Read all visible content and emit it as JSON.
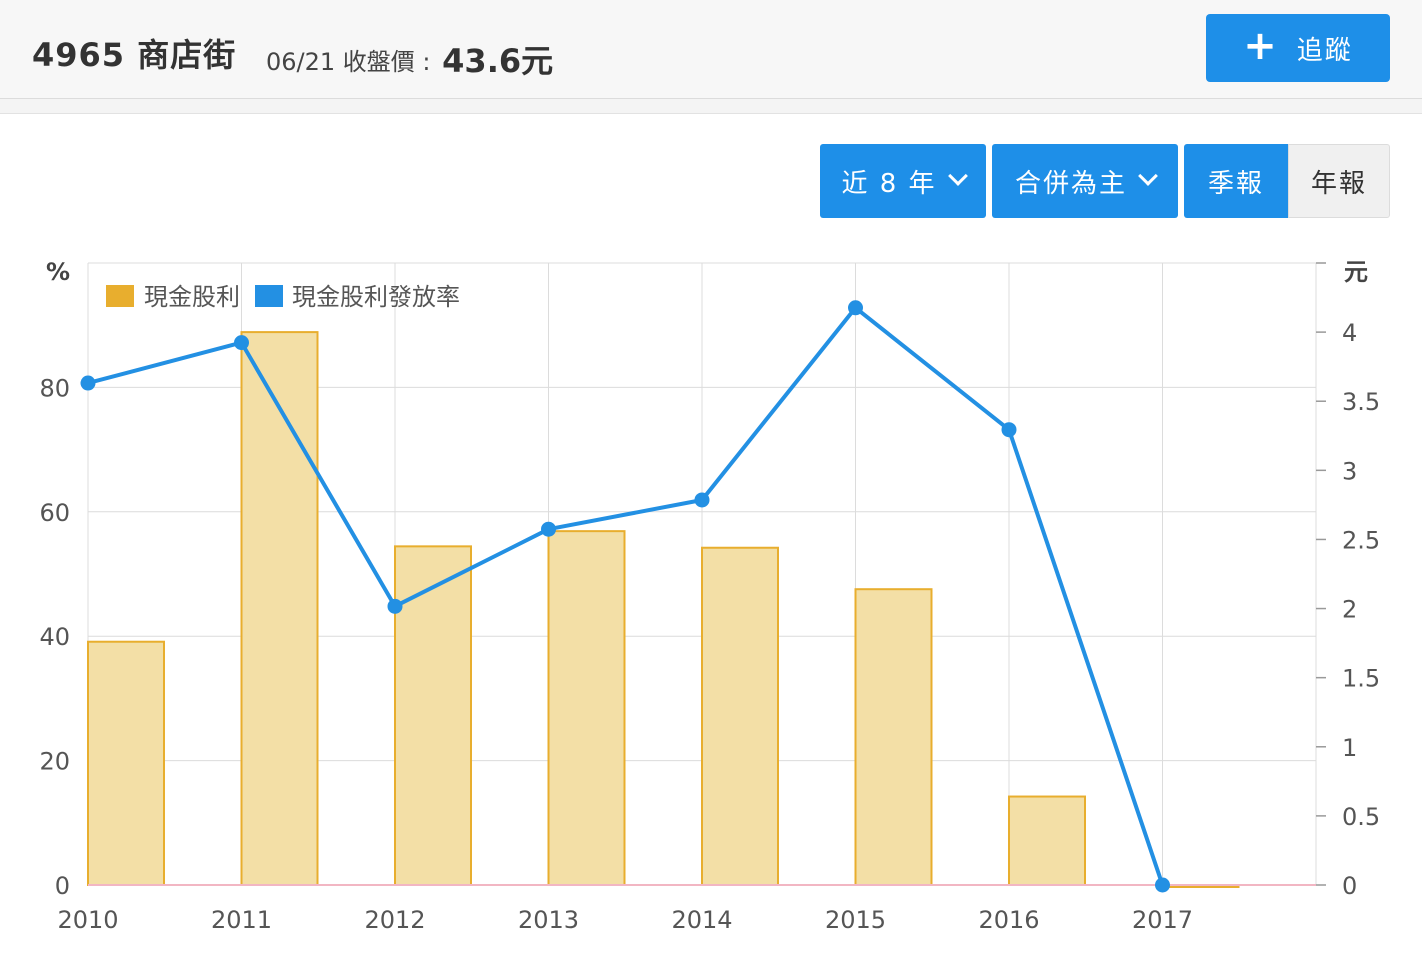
{
  "header": {
    "stock_title": "4965 商店街",
    "price_label": "06/21 收盤價 :",
    "price_value": "43.6元",
    "track_button": "追蹤"
  },
  "controls": {
    "range": "近 8 年",
    "basis": "合併為主",
    "quarterly": "季報",
    "annual": "年報"
  },
  "colors": {
    "accent": "#1e8fe8",
    "bar_fill": "#f3dfa6",
    "bar_stroke": "#e8ae2e",
    "line": "#2390e3"
  },
  "chart_data": {
    "type": "bar",
    "categories": [
      "2010",
      "2011",
      "2012",
      "2013",
      "2014",
      "2015",
      "2016",
      "2017"
    ],
    "y_left_unit": "%",
    "y_right_unit": "元",
    "y_left_ticks": [
      "0",
      "20",
      "40",
      "60",
      "80"
    ],
    "y_right_ticks": [
      "0",
      "0.5",
      "1",
      "1.5",
      "2",
      "2.5",
      "3",
      "3.5",
      "4"
    ],
    "ylim_left": [
      0,
      100
    ],
    "ylim_right": [
      0,
      4.5
    ],
    "grid": true,
    "legend_position": "top-left",
    "series": [
      {
        "name": "現金股利",
        "type": "bar",
        "axis": "right",
        "values": [
          1.76,
          4.0,
          2.45,
          2.56,
          2.44,
          2.14,
          0.64,
          0.0
        ]
      },
      {
        "name": "現金股利發放率",
        "type": "line",
        "axis": "left",
        "values": [
          80.7,
          87.2,
          44.8,
          57.2,
          61.9,
          92.8,
          73.2,
          0.0
        ]
      }
    ]
  }
}
